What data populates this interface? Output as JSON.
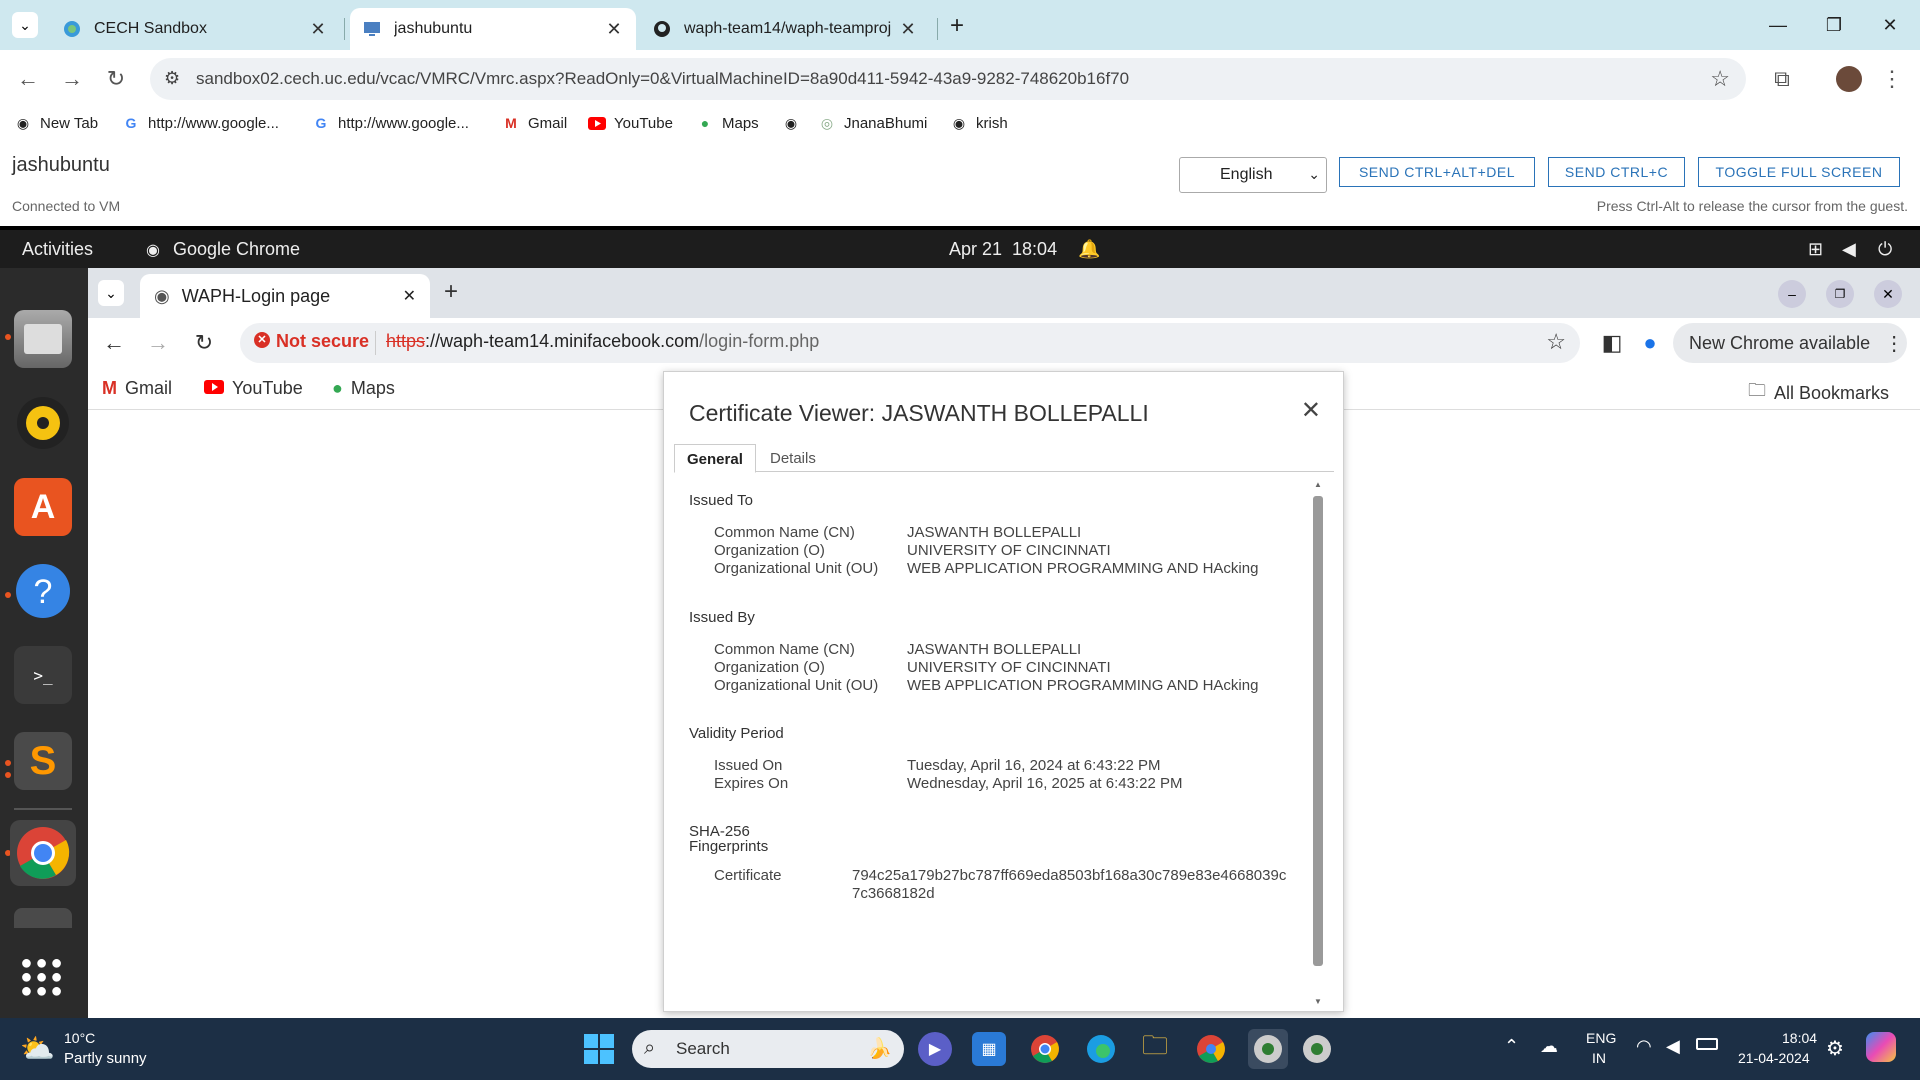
{
  "host": {
    "tabs": [
      {
        "title": "CECH Sandbox"
      },
      {
        "title": "jashubuntu"
      },
      {
        "title": "waph-team14/waph-teamproj"
      }
    ],
    "url": "sandbox02.cech.uc.edu/vcac/VMRC/Vmrc.aspx?ReadOnly=0&VirtualMachineID=8a90d411-5942-43a9-9282-748620b16f70",
    "bookmarks": [
      "New Tab",
      "http://www.google...",
      "http://www.google...",
      "Gmail",
      "YouTube",
      "Maps",
      "",
      "JnanaBhumi",
      "krish"
    ]
  },
  "vmrc": {
    "vm_name": "jashubuntu",
    "status": "Connected to VM",
    "language": "English",
    "btn_ctrl_alt_del": "SEND CTRL+ALT+DEL",
    "btn_ctrl_c": "SEND CTRL+C",
    "btn_fullscreen": "TOGGLE FULL SCREEN",
    "hint": "Press Ctrl-Alt to release the cursor from the guest."
  },
  "ubuntu": {
    "activities": "Activities",
    "app": "Google Chrome",
    "datetime": "Apr 21  18:04"
  },
  "guest": {
    "tab_title": "WAPH-Login page",
    "not_secure": "Not secure",
    "url_scheme": "https",
    "url_host": "://waph-team14.minifacebook.com",
    "url_path": "/login-form.php",
    "update": "New Chrome available",
    "bookmarks": [
      "Gmail",
      "YouTube",
      "Maps"
    ],
    "all_bookmarks": "All Bookmarks"
  },
  "cert": {
    "title": "Certificate Viewer: JASWANTH BOLLEPALLI",
    "tabs": [
      "General",
      "Details"
    ],
    "issued_to": {
      "heading": "Issued To",
      "cn_label": "Common Name (CN)",
      "cn": "JASWANTH BOLLEPALLI",
      "o_label": "Organization (O)",
      "o": "UNIVERSITY OF CINCINNATI",
      "ou_label": "Organizational Unit (OU)",
      "ou": "WEB APPLICATION PROGRAMMING AND HAcking"
    },
    "issued_by": {
      "heading": "Issued By",
      "cn_label": "Common Name (CN)",
      "cn": "JASWANTH BOLLEPALLI",
      "o_label": "Organization (O)",
      "o": "UNIVERSITY OF CINCINNATI",
      "ou_label": "Organizational Unit (OU)",
      "ou": "WEB APPLICATION PROGRAMMING AND HAcking"
    },
    "validity": {
      "heading": "Validity Period",
      "issued_label": "Issued On",
      "issued": "Tuesday, April 16, 2024 at 6:43:22 PM",
      "expires_label": "Expires On",
      "expires": "Wednesday, April 16, 2025 at 6:43:22 PM"
    },
    "fingerprints": {
      "heading1": "SHA-256",
      "heading2": "Fingerprints",
      "cert_label": "Certificate",
      "cert_line1": "794c25a179b27bc787ff669eda8503bf168a30c789e83e4668039c",
      "cert_line2": "7c3668182d"
    }
  },
  "taskbar": {
    "temp": "10°C",
    "weather": "Partly sunny",
    "search": "Search",
    "lang1": "ENG",
    "lang2": "IN",
    "time": "18:04",
    "date": "21-04-2024"
  }
}
